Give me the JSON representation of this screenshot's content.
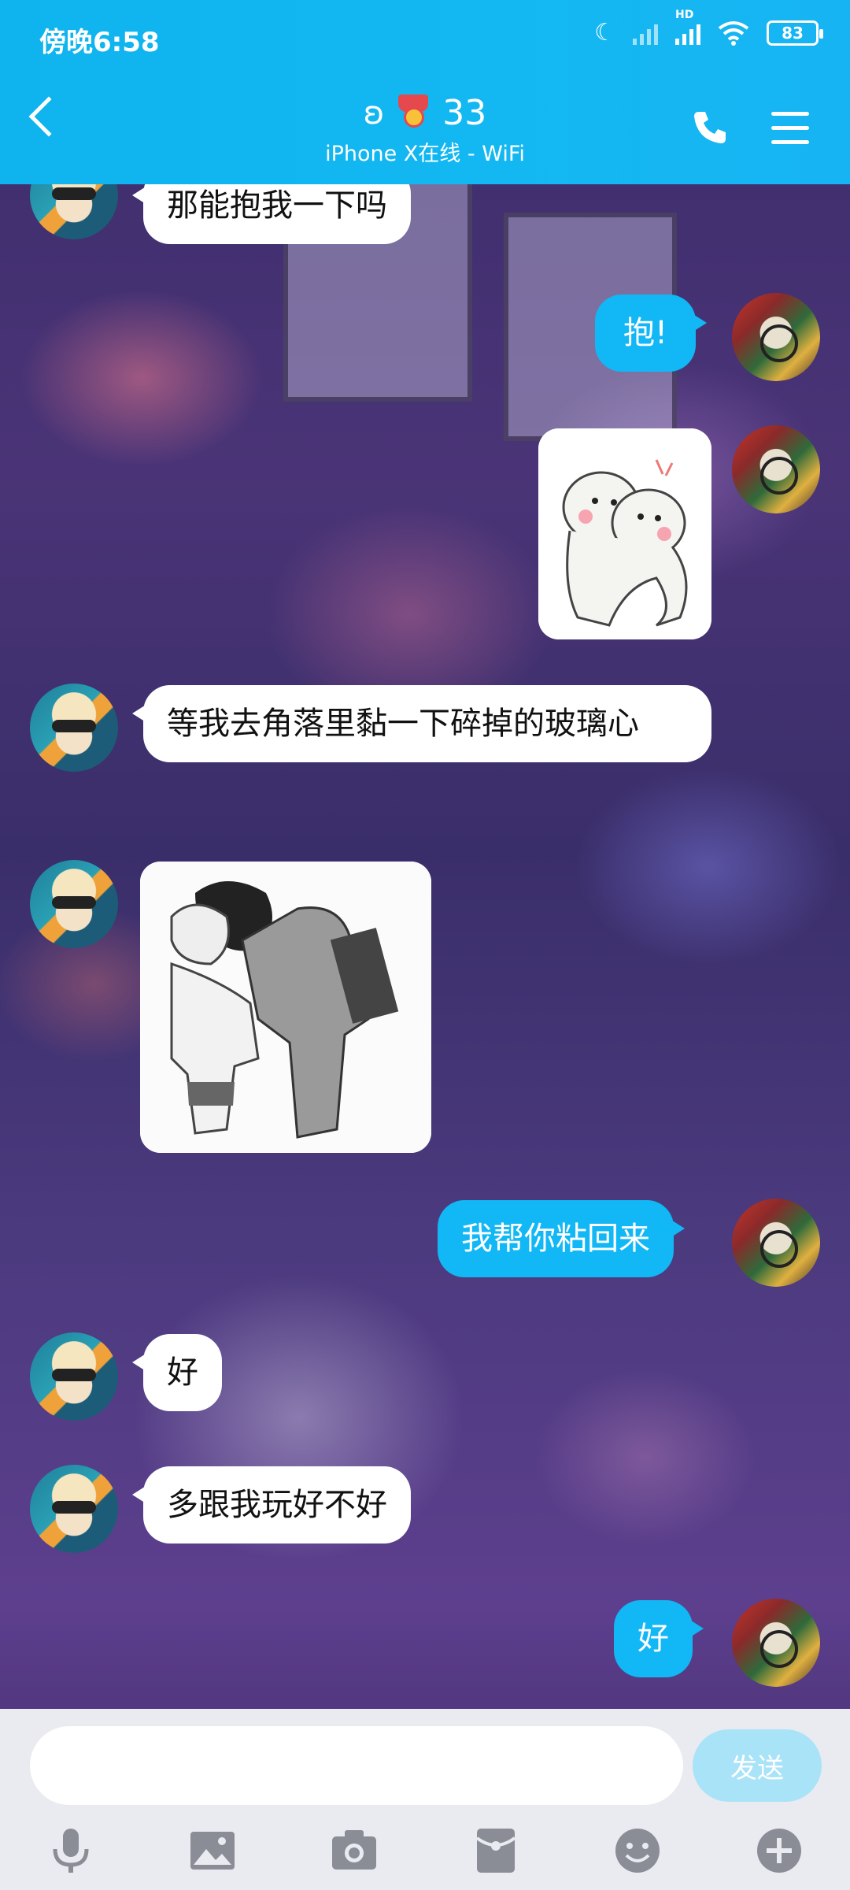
{
  "status": {
    "time": "傍晚6:58",
    "network_label": "HD",
    "battery": "83"
  },
  "header": {
    "title_number": "33",
    "subtitle": "iPhone X在线 - WiFi"
  },
  "messages": [
    {
      "side": "them",
      "type": "text",
      "text": "那能抱我一下吗"
    },
    {
      "side": "me",
      "type": "text",
      "text": "抱!"
    },
    {
      "side": "me",
      "type": "sticker",
      "text": ""
    },
    {
      "side": "them",
      "type": "text",
      "text": "等我去角落里黏一下碎掉的玻璃心"
    },
    {
      "side": "them",
      "type": "image",
      "text": ""
    },
    {
      "side": "me",
      "type": "text",
      "text": "我帮你粘回来"
    },
    {
      "side": "them",
      "type": "text",
      "text": "好"
    },
    {
      "side": "them",
      "type": "text",
      "text": "多跟我玩好不好"
    },
    {
      "side": "me",
      "type": "text",
      "text": "好"
    }
  ],
  "composer": {
    "placeholder": "",
    "send_label": "发送"
  },
  "toolbar_icons": [
    "microphone-icon",
    "image-icon",
    "camera-icon",
    "red-packet-icon",
    "emoji-icon",
    "plus-icon"
  ],
  "colors": {
    "header": "#12b7f5",
    "my_bubble": "#12b7f5",
    "their_bubble": "#ffffff",
    "send_disabled": "#a9e3f8"
  }
}
